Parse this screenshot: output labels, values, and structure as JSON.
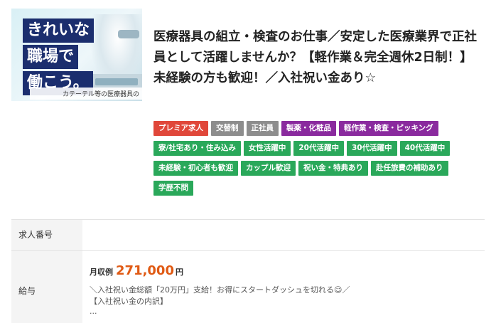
{
  "thumbnail": {
    "line1": "きれいな",
    "line2": "職場で",
    "line3": "働こう。",
    "caption": "カテーテル等の医療器具の"
  },
  "job": {
    "title": "医療器具の組立・検査のお仕事／安定した医療業界で正社員として活躍しませんか？【軽作業＆完全週休2日制！】未経験の方も歓迎！／入社祝い金あり☆"
  },
  "tags": [
    {
      "label": "プレミア求人",
      "color": "#e0473a"
    },
    {
      "label": "交替制",
      "color": "#8d8d8d"
    },
    {
      "label": "正社員",
      "color": "#8d8d8d"
    },
    {
      "label": "製薬・化粧品",
      "color": "#8a2a9e"
    },
    {
      "label": "軽作業・検査・ピッキング",
      "color": "#8a2a9e"
    },
    {
      "label": "寮/社宅あり・住み込み",
      "color": "#2aa85a"
    },
    {
      "label": "女性活躍中",
      "color": "#2aa85a"
    },
    {
      "label": "20代活躍中",
      "color": "#2aa85a"
    },
    {
      "label": "30代活躍中",
      "color": "#2aa85a"
    },
    {
      "label": "40代活躍中",
      "color": "#2aa85a"
    },
    {
      "label": "未経験・初心者も歓迎",
      "color": "#2aa85a"
    },
    {
      "label": "カップル歓迎",
      "color": "#2aa85a"
    },
    {
      "label": "祝い金・特典あり",
      "color": "#2aa85a"
    },
    {
      "label": "赴任旅費の補助あり",
      "color": "#2aa85a"
    },
    {
      "label": "学歴不問",
      "color": "#2aa85a"
    }
  ],
  "details": {
    "job_number_label": "求人番号",
    "job_number_value": "",
    "salary_label": "給与",
    "salary_prefix": "月収例",
    "salary_amount": "271,000",
    "salary_unit": "円",
    "salary_desc1": "＼入社祝い金総額「20万円」支給！お得にスタートダッシュを切れる☺／",
    "salary_desc2": "【入社祝い金の内訳】",
    "salary_desc3": "..."
  }
}
